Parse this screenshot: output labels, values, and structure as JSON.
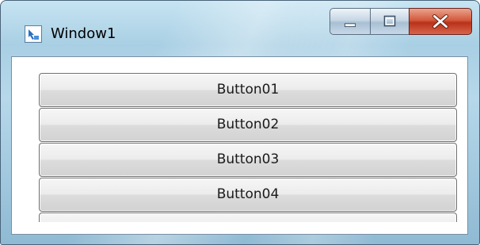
{
  "window": {
    "title": "Window1",
    "app_icon": "wpf-window-icon",
    "caption_buttons": {
      "minimize_icon": "minimize-icon",
      "maximize_icon": "maximize-icon",
      "close_icon": "close-icon"
    }
  },
  "buttons": [
    {
      "label": "Button01"
    },
    {
      "label": "Button02"
    },
    {
      "label": "Button03"
    },
    {
      "label": "Button04"
    },
    {
      "label": ""
    }
  ],
  "colors": {
    "titlebar_glass": "#b6d8ea",
    "close_button": "#c8442a",
    "button_face": "#e6e6e6",
    "button_border": "#707070"
  }
}
